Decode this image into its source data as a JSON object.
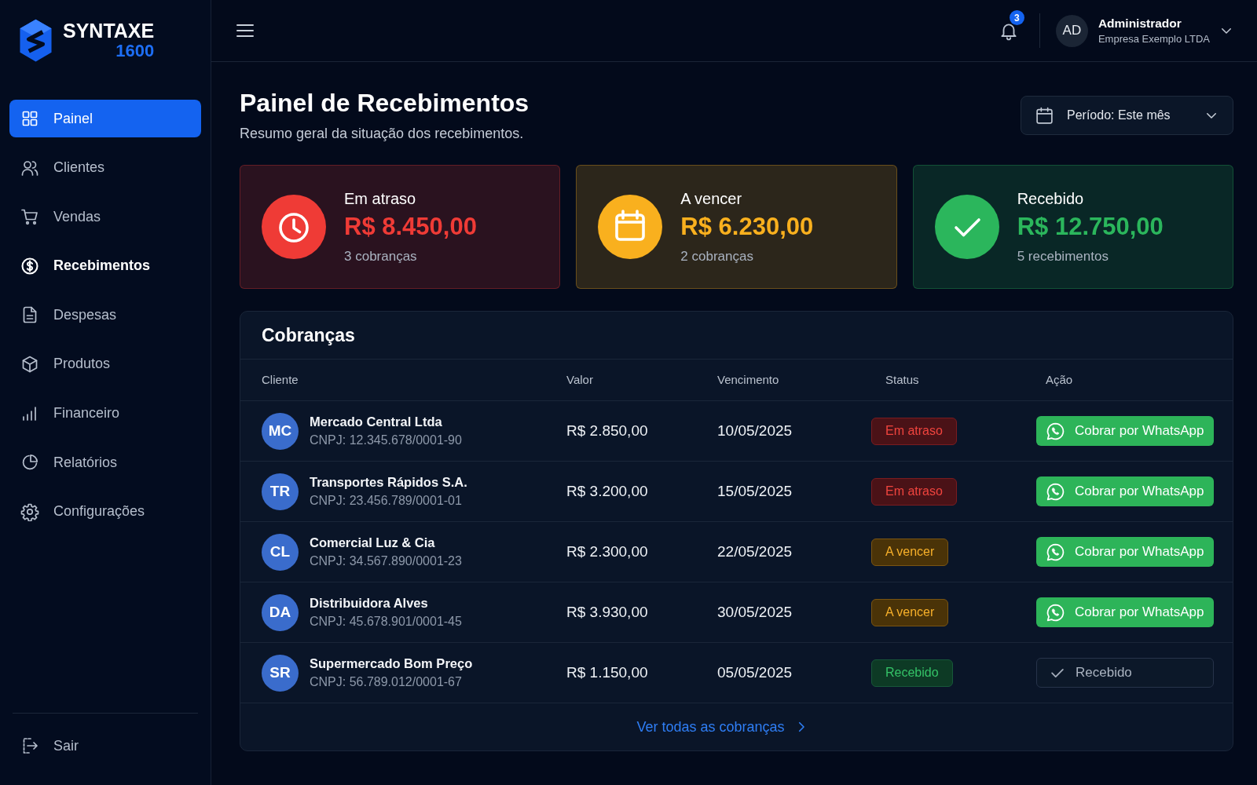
{
  "sidebar": {
    "logo": {
      "name": "SYNTAXE",
      "number": "1600"
    },
    "items": [
      {
        "label": "Painel",
        "selected": true,
        "highlighted": false
      },
      {
        "label": "Clientes",
        "selected": false,
        "highlighted": false
      },
      {
        "label": "Vendas",
        "selected": false,
        "highlighted": false
      },
      {
        "label": "Recebimentos",
        "selected": false,
        "highlighted": true
      },
      {
        "label": "Despesas",
        "selected": false,
        "highlighted": false
      },
      {
        "label": "Produtos",
        "selected": false,
        "highlighted": false
      },
      {
        "label": "Financeiro",
        "selected": false,
        "highlighted": false
      },
      {
        "label": "Relatórios",
        "selected": false,
        "highlighted": false
      },
      {
        "label": "Configurações",
        "selected": false,
        "highlighted": false
      }
    ],
    "footer_item": {
      "label": "Sair"
    }
  },
  "header": {
    "notifications": {
      "count": "3"
    },
    "user": {
      "initials": "AD",
      "name": "Administrador",
      "company": "Empresa Exemplo LTDA"
    }
  },
  "page": {
    "title": "Painel de Recebimentos",
    "subtitle": "Resumo geral da situação dos recebimentos.",
    "period": {
      "label": "Período: Este mês"
    }
  },
  "summary_cards": [
    {
      "kind": "overdue",
      "color": "#ef3b36",
      "label": "Em atraso",
      "amount": "R$ 8.450,00",
      "detail": "3 cobranças"
    },
    {
      "kind": "due",
      "color": "#f9b01e",
      "label": "A vencer",
      "amount": "R$ 6.230,00",
      "detail": "2 cobranças"
    },
    {
      "kind": "received",
      "color": "#2bb65c",
      "label": "Recebido",
      "amount": "R$ 12.750,00",
      "detail": "5 recebimentos"
    }
  ],
  "table": {
    "title": "Cobranças",
    "columns": [
      "Cliente",
      "Valor",
      "Vencimento",
      "Status",
      "Ação"
    ],
    "rows": [
      {
        "initials": "MC",
        "name": "Mercado Central Ltda",
        "cnpj": "CNPJ: 12.345.678/0001-90",
        "value": "R$ 2.850,00",
        "due_date": "10/05/2025",
        "status": {
          "kind": "overdue",
          "label": "Em atraso"
        },
        "action": {
          "kind": "whatsapp",
          "label": "Cobrar por WhatsApp"
        }
      },
      {
        "initials": "TR",
        "name": "Transportes Rápidos S.A.",
        "cnpj": "CNPJ: 23.456.789/0001-01",
        "value": "R$ 3.200,00",
        "due_date": "15/05/2025",
        "status": {
          "kind": "overdue",
          "label": "Em atraso"
        },
        "action": {
          "kind": "whatsapp",
          "label": "Cobrar por WhatsApp"
        }
      },
      {
        "initials": "CL",
        "name": "Comercial Luz & Cia",
        "cnpj": "CNPJ: 34.567.890/0001-23",
        "value": "R$ 2.300,00",
        "due_date": "22/05/2025",
        "status": {
          "kind": "due",
          "label": "A vencer"
        },
        "action": {
          "kind": "whatsapp",
          "label": "Cobrar por WhatsApp"
        }
      },
      {
        "initials": "DA",
        "name": "Distribuidora Alves",
        "cnpj": "CNPJ: 45.678.901/0001-45",
        "value": "R$ 3.930,00",
        "due_date": "30/05/2025",
        "status": {
          "kind": "due",
          "label": "A vencer"
        },
        "action": {
          "kind": "whatsapp",
          "label": "Cobrar por WhatsApp"
        }
      },
      {
        "initials": "SR",
        "name": "Supermercado Bom Preço",
        "cnpj": "CNPJ: 56.789.012/0001-67",
        "value": "R$ 1.150,00",
        "due_date": "05/05/2025",
        "status": {
          "kind": "received",
          "label": "Recebido"
        },
        "action": {
          "kind": "done",
          "label": "Recebido"
        }
      }
    ],
    "footer_link": {
      "label": "Ver todas as cobranças"
    }
  }
}
